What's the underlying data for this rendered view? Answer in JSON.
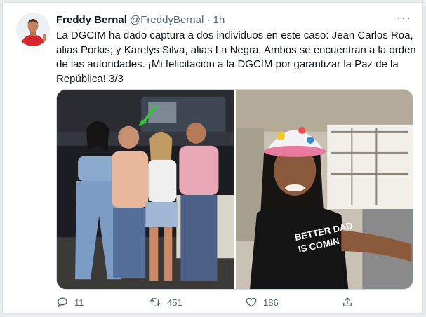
{
  "tweet": {
    "display_name": "Freddy Bernal",
    "handle": "@FreddyBernal",
    "separator": "·",
    "time": "1h",
    "more_label": "···",
    "text": "La DGCIM ha dado captura a dos individuos en este caso: Jean Carlos Roa, alias Porkis; y Karelys Silva, alias La Negra. Ambos se encuentran a la orden de las autoridades. ¡Mi felicitación a la DGCIM por garantizar la Paz de la República! 3/3",
    "photo_right_shirt_text": [
      "BETTER DAD",
      "IS COMIN"
    ]
  },
  "actions": {
    "reply_count": "11",
    "retweet_count": "451",
    "like_count": "186"
  },
  "colors": {
    "icon": "#536471",
    "name": "#0f1419",
    "avatar_shirt": "#d9262c"
  },
  "icons": [
    "reply-icon",
    "retweet-icon",
    "like-icon",
    "share-icon",
    "more-icon"
  ]
}
